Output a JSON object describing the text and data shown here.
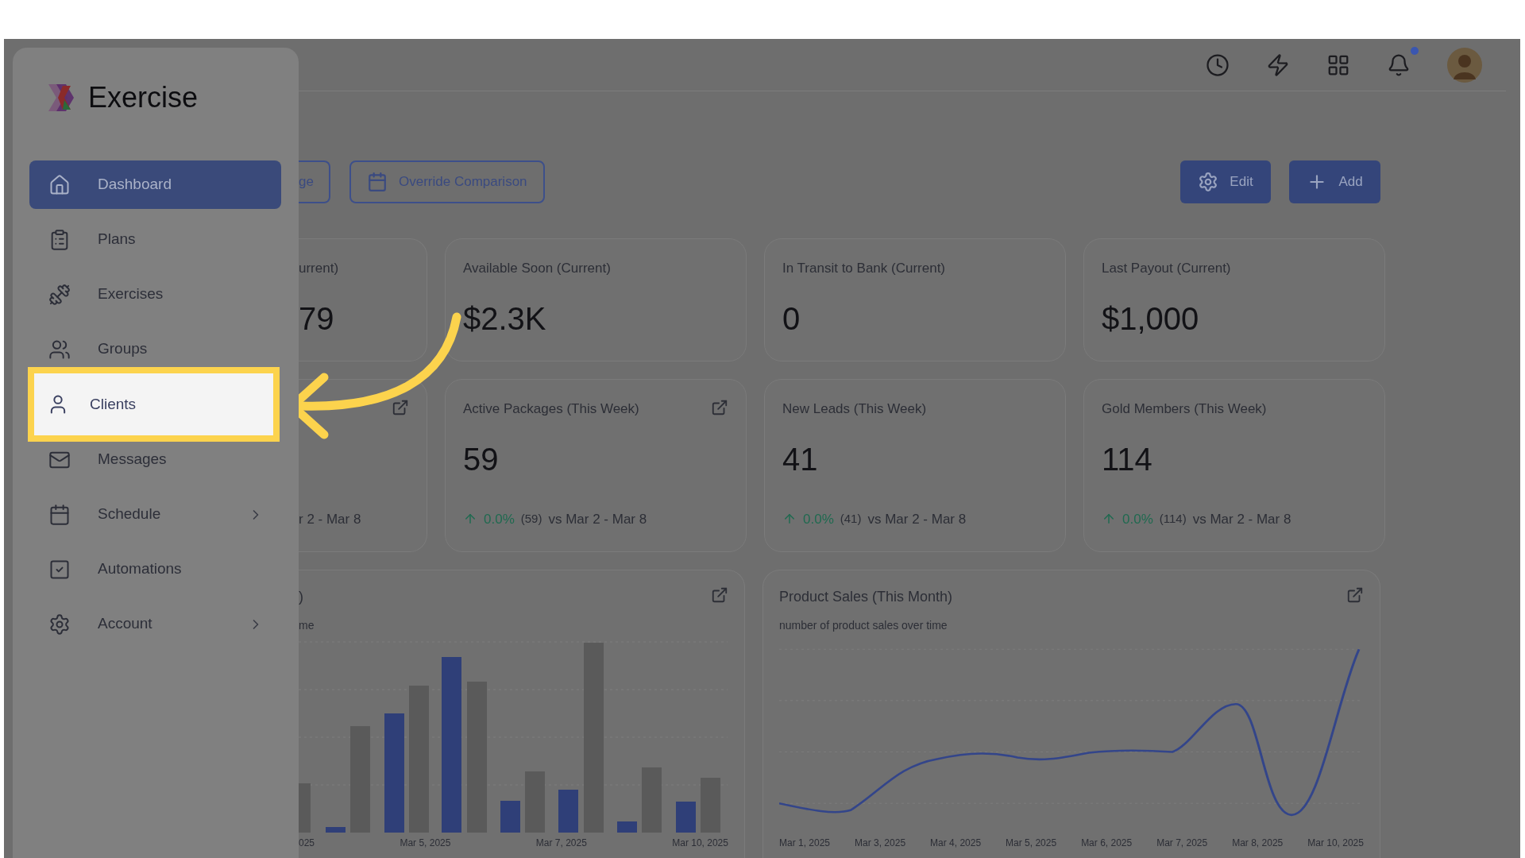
{
  "sidebar": {
    "brand": "Exercise",
    "items": [
      {
        "label": "Dashboard",
        "selected": true,
        "highlighted": false,
        "expandable": false
      },
      {
        "label": "Plans",
        "selected": false,
        "highlighted": false,
        "expandable": false
      },
      {
        "label": "Exercises",
        "selected": false,
        "highlighted": false,
        "expandable": false
      },
      {
        "label": "Groups",
        "selected": false,
        "highlighted": false,
        "expandable": false
      },
      {
        "label": "Clients",
        "selected": false,
        "highlighted": true,
        "expandable": false
      },
      {
        "label": "Messages",
        "selected": false,
        "highlighted": false,
        "expandable": false
      },
      {
        "label": "Schedule",
        "selected": false,
        "highlighted": false,
        "expandable": true
      },
      {
        "label": "Automations",
        "selected": false,
        "highlighted": false,
        "expandable": false
      },
      {
        "label": "Account",
        "selected": false,
        "highlighted": false,
        "expandable": true
      }
    ]
  },
  "toolbar": {
    "filters": [
      "ge",
      "Override Comparison"
    ],
    "actions": [
      "Edit",
      "Add"
    ]
  },
  "stat_rows": [
    [
      {
        "title": "urrent)",
        "value": "79",
        "link": false
      },
      {
        "title": "Available Soon (Current)",
        "value": "$2.3K",
        "link": false
      },
      {
        "title": "In Transit to Bank (Current)",
        "value": "0",
        "link": false
      },
      {
        "title": "Last Payout (Current)",
        "value": "$1,000",
        "link": false
      }
    ],
    [
      {
        "link": true,
        "compare": "r 2 - Mar 8"
      },
      {
        "title": "Active Packages (This Week)",
        "value": "59",
        "link": true,
        "change": "0.0%",
        "count": "(59)",
        "compare": "vs Mar 2 - Mar 8"
      },
      {
        "title": "New Leads (This Week)",
        "value": "41",
        "link": false,
        "change": "0.0%",
        "count": "(41)",
        "compare": "vs Mar 2 - Mar 8"
      },
      {
        "title": "Gold Members (This Week)",
        "value": "114",
        "link": false,
        "change": "0.0%",
        "count": "(114)",
        "compare": "vs Mar 2 - Mar 8"
      }
    ]
  ],
  "charts": [
    {
      "kind": "bar",
      "title": ")",
      "subtitle": "me",
      "x_labels": [
        "025",
        "Mar 5, 2025",
        "Mar 7, 2025",
        "Mar 10, 2025"
      ]
    },
    {
      "kind": "line",
      "title": "Product Sales (This Month)",
      "subtitle": "number of product sales over time",
      "x_labels": [
        "Mar 1, 2025",
        "Mar 3, 2025",
        "Mar 4, 2025",
        "Mar 5, 2025",
        "Mar 6, 2025",
        "Mar 7, 2025",
        "Mar 8, 2025",
        "Mar 10, 2025"
      ]
    }
  ]
}
